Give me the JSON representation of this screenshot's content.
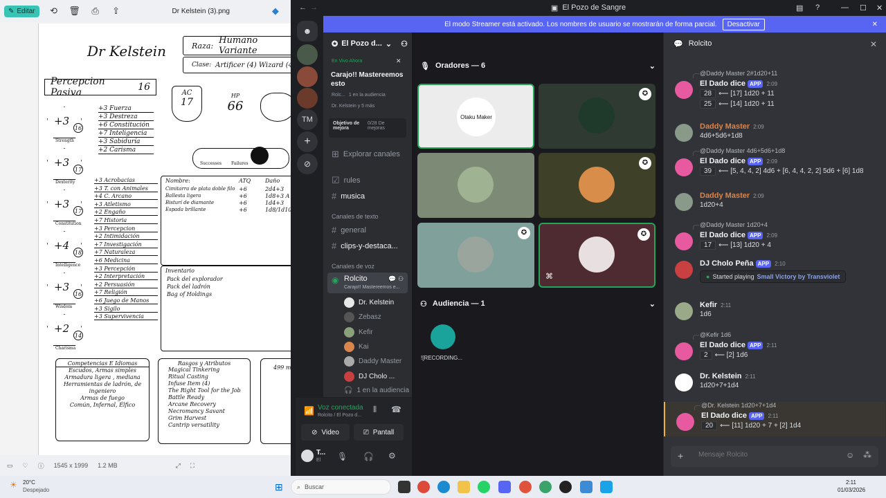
{
  "viewer": {
    "edit_label": "Editar",
    "filename": "Dr Kelstein (3).png",
    "dimensions": "1545 x 1999",
    "filesize": "1.2 MB"
  },
  "sheet": {
    "name": "Dr Kelstein",
    "race_label": "Raza:",
    "race": "Humano Variante",
    "class_label": "Clase:",
    "class": "Artificer (4) Wizard (4)",
    "passive_label": "Percepcion Pasiva",
    "passive": "16",
    "ac_label": "AC",
    "ac": "17",
    "hp_label": "HP",
    "hp": "66",
    "successes": "Successes",
    "failures": "Failures",
    "abilities": [
      {
        "mod": "+3",
        "score": "16",
        "name": "Strength"
      },
      {
        "mod": "+3",
        "score": "17",
        "name": "Dexterity"
      },
      {
        "mod": "+3",
        "score": "17",
        "name": "Constitution"
      },
      {
        "mod": "+4",
        "score": "18",
        "name": "Intelligence"
      },
      {
        "mod": "+3",
        "score": "16",
        "name": "Wisdom"
      },
      {
        "mod": "+2",
        "score": "14",
        "name": "Charisma"
      }
    ],
    "saves": [
      "+3 Fuerza",
      "+3 Destreza",
      "+6 Constitución",
      "+7 Inteligencia",
      "+3 Sabiduría",
      "+2 Carisma"
    ],
    "skills": [
      "+3 Acrobacias",
      "+3 T. con Animales",
      "+4 C. Arcano",
      "+3 Atletismo",
      "+2 Engaño",
      "+7 Historia",
      "+3 Percepcion",
      "+2 Intimidación",
      "+7 Investigación",
      "+7 Naturaleza",
      "+6 Medicina",
      "+3 Percepción",
      "+2 Interpretación",
      "+2 Persuasión",
      "+7 Religión",
      "+6 Juego de Manos",
      "+3 Sigilo",
      "+3 Supervivencia"
    ],
    "weapon_headers": [
      "Nombre:",
      "ATQ",
      "Daño"
    ],
    "weapons": [
      [
        "Cimitarra de plata doble filo",
        "+6",
        "2d4+3"
      ],
      [
        "Ballesta ligera",
        "+6",
        "1d8+3 A"
      ],
      [
        "Bisturí de diamante",
        "+6",
        "1d4+3"
      ],
      [
        "Espada brillante",
        "+6",
        "1d8/1d10+"
      ]
    ],
    "inventory_title": "Inventario",
    "inventory": [
      "Pack del explorador",
      "Pack del ladrón",
      "Bag of Holdings"
    ],
    "prof_title": "Competencias E Idiomas",
    "prof": [
      "Escudos, Armas simples",
      "Armadura ligera , mediana",
      "Herramientas de ladrón, de ingeniero",
      "Armas de fuego",
      "Común, Infernal, Élfico"
    ],
    "traits_title": "Rasgos y Atributos",
    "traits": [
      "Magical Tinkering",
      "Ritual Casting",
      "Infuse Item (4)",
      "The Right Tool for the Job",
      "Battle Ready",
      "Arcane Recovery",
      "Necromancy Savant",
      "Grim Harvest",
      "Cantrip versatility"
    ],
    "extra": "499 m"
  },
  "discord": {
    "window_title": "El Pozo de Sangre",
    "streamer_notice": "El modo Streamer está activado. Los nombres de usuario se mostrarán de forma parcial.",
    "streamer_btn": "Desactivar",
    "guild_label": "TM",
    "server_name": "El Pozo d...",
    "live_label": "En Vivo Ahora",
    "event_title": "Carajo!! Mastereemos esto",
    "event_meta1": "Rolc...",
    "event_meta2": "1 en la audiencia",
    "event_meta3": "Dr. Kelstein y 5 más",
    "boost_label": "Objetivo de mejora",
    "boost_value": "0/28 De mejoras",
    "explore": "Explorar canales",
    "channels_top": [
      "rules",
      "musica"
    ],
    "text_cat": "Canales de texto",
    "text_channels": [
      "general",
      "clips-y-destaca..."
    ],
    "voice_cat": "Canales de voz",
    "voice_channel": "Rolcito",
    "voice_sub": "Carajo!! Mastereemos e...",
    "voice_users": [
      "Dr. Kelstein",
      "Zebasz",
      "Kefir",
      "Kai",
      "Daddy Master",
      "DJ Cholo ..."
    ],
    "audience_note": "1 en la audiencia",
    "connected": "Voz conectada",
    "connected_sub": "Rolcito / El Pozo d...",
    "video_btn": "Video",
    "screen_btn": "Pantall",
    "user_short": "T...",
    "user_status": "El",
    "speakers_title": "Oradores — 6",
    "audience_title": "Audiencia — 1",
    "audience_user": "![RECORDING...",
    "otaku_text": "Otaku Maker",
    "chat_channel": "Rolcito",
    "chat_placeholder": "Mensaje Rolcito"
  },
  "messages": [
    {
      "reply": "@Daddy Master 2#1d20+11",
      "name": "El Dado dice",
      "app": "APP",
      "time": "2:09",
      "lines": [
        [
          "28",
          "⟵ [17] 1d20 + 11"
        ],
        [
          "25",
          "⟵ [14] 1d20 + 11"
        ]
      ]
    },
    {
      "name": "Daddy Master",
      "time": "2:09",
      "text": "4d6+5d6+1d8"
    },
    {
      "reply": "@Daddy Master 4d6+5d6+1d8",
      "name": "El Dado dice",
      "app": "APP",
      "time": "2:09",
      "lines": [
        [
          "39",
          "⟵ [5, 4, 4, 2] 4d6 + [6, 4, 4, 2, 2] 5d6 + [6] 1d8"
        ]
      ]
    },
    {
      "name": "Daddy Master",
      "time": "2:09",
      "text": "1d20+4"
    },
    {
      "reply": "@Daddy Master 1d20+4",
      "name": "El Dado dice",
      "app": "APP",
      "time": "2:09",
      "lines": [
        [
          "17",
          "⟵ [13] 1d20 + 4"
        ]
      ]
    },
    {
      "name": "DJ Cholo Peña",
      "app": "APP",
      "time": "2:10",
      "activity": "Started playing",
      "activity_link": "Small Victory by Transviolet"
    },
    {
      "name": "Kefir",
      "time": "2:11",
      "text": "1d6"
    },
    {
      "reply": "@Kefir 1d6",
      "name": "El Dado dice",
      "app": "APP",
      "time": "2:11",
      "lines": [
        [
          "2",
          "⟵ [2] 1d6"
        ]
      ]
    },
    {
      "name": "Dr. Kelstein",
      "time": "2:11",
      "text": "1d20+7+1d4"
    },
    {
      "reply": "@Dr. Kelstein 1d20+7+1d4",
      "name": "El Dado dice",
      "app": "APP",
      "time": "2:11",
      "lines": [
        [
          "20",
          "⟵ [11] 1d20 + 7 + [2] 1d4"
        ]
      ]
    }
  ],
  "taskbar": {
    "temp": "20°C",
    "weather": "Despejado",
    "search": "Buscar",
    "time": "2:11",
    "date": "01/03/2026"
  },
  "colors": {
    "blurple": "#5865f2",
    "orange_name": "#d9854b",
    "green": "#23a55a"
  }
}
